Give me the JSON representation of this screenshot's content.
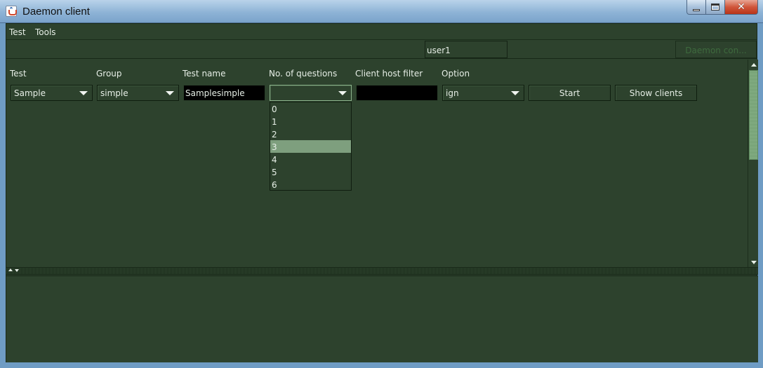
{
  "window": {
    "title": "Daemon client",
    "close_glyph": "✕"
  },
  "menu": {
    "items": [
      "Test",
      "Tools"
    ]
  },
  "toolbar": {
    "user_value": "user1",
    "daemon_button_label": "Daemon con..."
  },
  "form": {
    "labels": {
      "test": "Test",
      "group": "Group",
      "test_name": "Test name",
      "num_questions": "No. of questions",
      "client_host_filter": "Client host filter",
      "option": "Option"
    },
    "test_value": "Sample",
    "group_value": "simple",
    "test_name_value": "Samplesimple",
    "num_questions_value": "",
    "client_host_filter_value": "",
    "option_value": "ign",
    "start_label": "Start",
    "show_clients_label": "Show clients"
  },
  "dropdown": {
    "options": [
      "0",
      "1",
      "2",
      "3",
      "4",
      "5",
      "6"
    ],
    "highlighted": "3"
  },
  "colors": {
    "background": "#2d422d",
    "highlight": "#7e9f7e",
    "text": "#e6eee6"
  }
}
